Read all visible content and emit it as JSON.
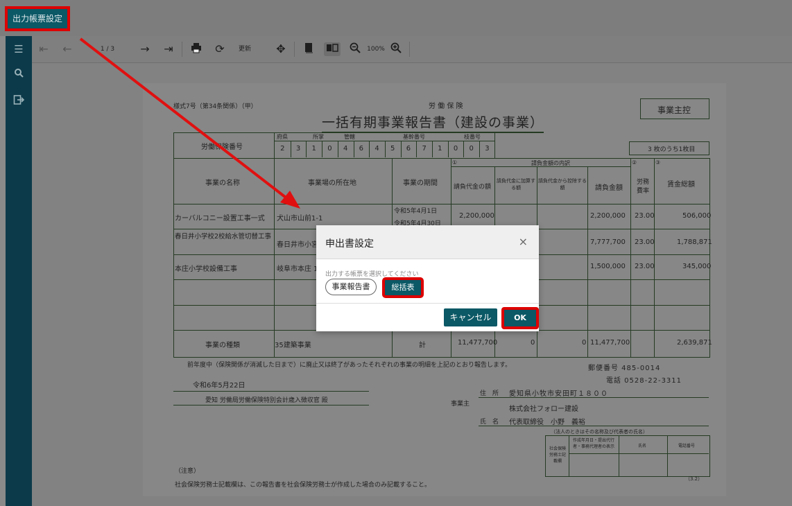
{
  "header": {
    "output_settings_button": "出力帳票設定"
  },
  "toolbar": {
    "page_indicator": "1 / 3",
    "refresh_label": "更新",
    "zoom_level": "100%"
  },
  "doc": {
    "form_no": "様式7号（第34条関係）（甲）",
    "insurance_label": "労 働 保 険",
    "title": "一括有期事業報告書（建設の事業）",
    "employer_copy": "事業主控",
    "insurance_no_label": "労働保険番号",
    "insurance_no_headers": [
      "府県",
      "所掌",
      "管轄",
      "基幹番号",
      "枝番号"
    ],
    "insurance_no_digits": [
      "2",
      "3",
      "1",
      "0",
      "4",
      "6",
      "4",
      "5",
      "6",
      "7",
      "1",
      "0",
      "0",
      "3"
    ],
    "page_of": "3 枚のうち1枚目",
    "col_headers": {
      "name": "事業の名称",
      "location": "事業場の所在地",
      "period": "事業の期間",
      "contract_group": "請負金額の内訳",
      "c1": "請負代金の額",
      "c2": "請負代金に加算する額",
      "c3": "請負代金から控除する額",
      "c4": "請負金額",
      "rate": "労務費率",
      "wage": "賃金総額",
      "num1": "①",
      "num2": "②",
      "num3": "③"
    },
    "rows": [
      {
        "name": "カーバルコニー設置工事一式",
        "location": "犬山市山前1-1",
        "period_from": "令和5年4月1日",
        "period_to": "令和5年4月30日",
        "c1": "2,200,000",
        "c4": "2,200,000",
        "rate": "23.00",
        "wage": "506,000"
      },
      {
        "name": "春日井小学校2校給水管切替工事",
        "location": "春日井市小宮",
        "c4": "7,777,700",
        "rate": "23.00",
        "wage": "1,788,871"
      },
      {
        "name": "本庄小学校設備工事",
        "location": "岐阜市本庄 1",
        "c4": "1,500,000",
        "rate": "23.00",
        "wage": "345,000"
      }
    ],
    "total_row": {
      "kind_label": "事業の種類",
      "kind_value": "35建築事業",
      "total_label": "計",
      "c1": "11,477,700",
      "c2": "0",
      "c3": "0",
      "c4": "11,477,700",
      "wage": "2,639,871"
    },
    "statement": "前年度中（保険関係が消滅した日まで）に廃止又は終了があったそれぞれの事業の明細を上記のとおり報告します。",
    "date": "令和6年5月22日",
    "addressee": "愛知 労働局労働保険特別会計歳入徴収官 殿",
    "postal": "郵便番号 485-0014",
    "phone": "電話 0528-22-3311",
    "employer_label": "事業主",
    "address_label": "住　所",
    "address": "愛知県小牧市安田町１８００",
    "company": "株式会社フォロー建設",
    "name_label": "氏　名",
    "representative": "代表取締役　小野　義裕",
    "corp_note": "（法人のときはその名称及び代表者の氏名）",
    "agent_headers": [
      "作成年月日・提出代行者・事務代理者の表示",
      "氏名",
      "電話番号"
    ],
    "agent_side": "社会保険労務士記載欄",
    "notes_label": "（注意）",
    "notes": "社会保険労務士記載欄は、この報告書を社会保険労務士が作成した場合のみ記載すること。",
    "footer_mark": "（3.2）"
  },
  "modal": {
    "title": "申出書設定",
    "close_icon": "×",
    "hint": "出力する帳票を選択してください",
    "option_report": "事業報告書",
    "option_summary": "総括表",
    "cancel": "キャンセル",
    "ok": "OK"
  },
  "colors": {
    "accent": "#0b5866",
    "highlight": "#dd0000",
    "sidebar": "#0c3a4a"
  }
}
